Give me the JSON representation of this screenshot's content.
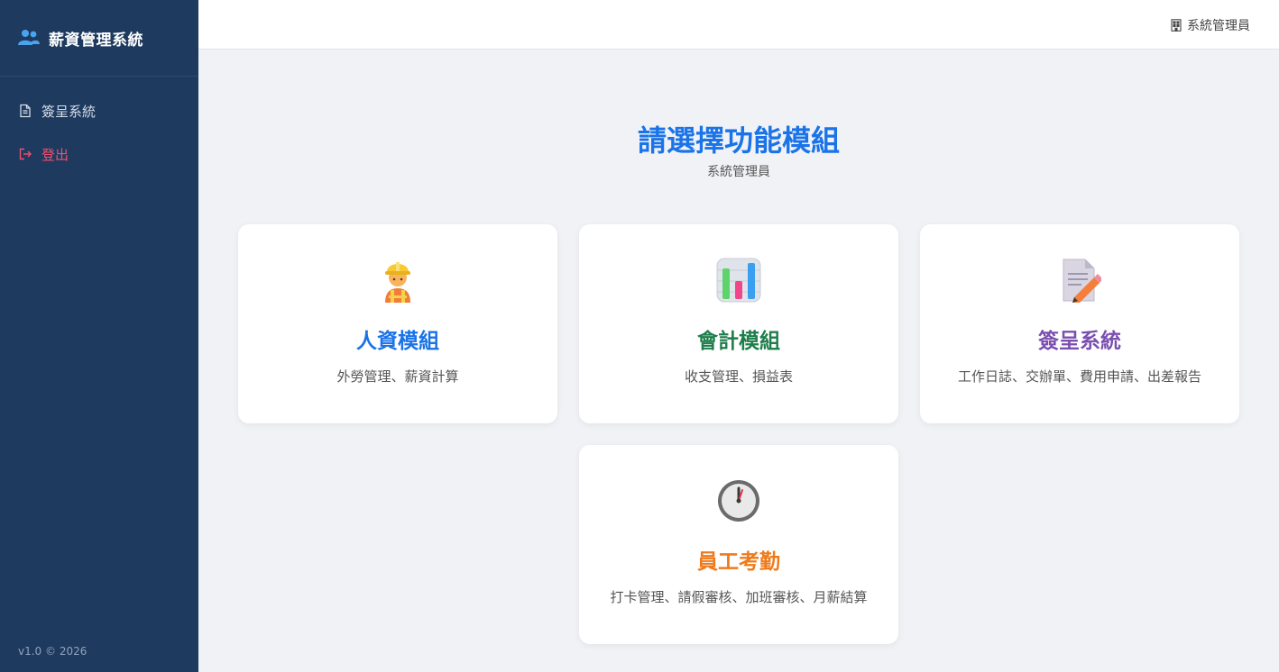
{
  "sidebar": {
    "title": "薪資管理系統",
    "items": [
      {
        "label": "簽呈系統",
        "icon": "document-icon"
      },
      {
        "label": "登出",
        "icon": "logout-icon"
      }
    ],
    "version": "v1.0 © 2026"
  },
  "topbar": {
    "user_label": "系統管理員",
    "user_icon": "building-icon"
  },
  "main": {
    "title": "請選擇功能模組",
    "subtitle": "系統管理員",
    "cards": [
      {
        "title": "人資模組",
        "description": "外勞管理、薪資計算",
        "icon": "construction-worker-icon",
        "color": "#1a73e8"
      },
      {
        "title": "會計模組",
        "description": "收支管理、損益表",
        "icon": "bar-chart-icon",
        "color": "#1e7e4a"
      },
      {
        "title": "簽呈系統",
        "description": "工作日誌、交辦單、費用申請、出差報告",
        "icon": "memo-icon",
        "color": "#7b4fb0"
      },
      {
        "title": "員工考勤",
        "description": "打卡管理、請假審核、加班審核、月薪結算",
        "icon": "clock-icon",
        "color": "#f07a1a"
      }
    ]
  },
  "colors": {
    "sidebar_bg": "#1e3a5f",
    "accent": "#1a73e8",
    "logout": "#f0506e"
  }
}
